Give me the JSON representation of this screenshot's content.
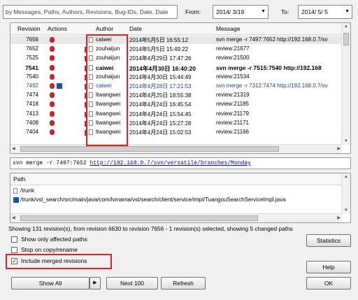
{
  "filter": {
    "placeholder": "by Messages, Paths, Authors, Revisions, Bug-IDs, Date, Date",
    "from_label": "From:",
    "from_value": "2014/ 3/19",
    "to_label": "To:",
    "to_value": "2014/ 5/ 5"
  },
  "log": {
    "columns": [
      "Revision",
      "Actions",
      "Author",
      "Date",
      "Message"
    ],
    "rows": [
      {
        "rev": "7656",
        "author": "caiwei",
        "date": "2014年5月5日 16:55:12",
        "msg": "svn merge -r 7497:7652 http://192.168.0.7/sv"
      },
      {
        "rev": "7652",
        "author": "zouhaijun",
        "date": "2014年5月5日 15:49:22",
        "msg": "review:21677"
      },
      {
        "rev": "7525",
        "author": "zouhaijun",
        "date": "2014年4月29日 17:47:26",
        "msg": "review:21500"
      },
      {
        "rev": "7541",
        "author": "caiwei",
        "date": "2014年4月30日 16:40:20",
        "msg": "svn merge -r 7515:7540 http://192.168"
      },
      {
        "rev": "7540",
        "author": "zouhaijun",
        "date": "2014年4月30日 15:44:49",
        "msg": "review:21534"
      },
      {
        "rev": "7492",
        "author": "caiwei",
        "date": "2014年4月28日 17:21:53",
        "msg": "svn merge -r 7312:7474 http://192.168.0.7/sv"
      },
      {
        "rev": "7474",
        "author": "ltwangwei",
        "date": "2014年4月25日 18:55:38",
        "msg": "review:21319"
      },
      {
        "rev": "7418",
        "author": "ltwangwei",
        "date": "2014年4月24日 16:45:54",
        "msg": "review:21185"
      },
      {
        "rev": "7413",
        "author": "ltwangwei",
        "date": "2014年4月24日 15:54:45",
        "msg": "review:21179"
      },
      {
        "rev": "7408",
        "author": "ltwangwei",
        "date": "2014年4月24日 15:27:28",
        "msg": "review:21171"
      },
      {
        "rev": "7404",
        "author": "ltwangwei",
        "date": "2014年4月24日 15:02:53",
        "msg": "review:21166"
      }
    ]
  },
  "message": {
    "prefix": "svn merge -r 7497:7652 ",
    "link": "http://192.168.0.7/svn/versatile/branches/Monday"
  },
  "paths": {
    "header": "Path",
    "items": [
      "/trunk",
      "/trunk/vst_search/src/main/java/com/lvmama/vst/search/client/service/impl/TuangouSearchServiceImpl.java"
    ]
  },
  "status": "Showing 131 revision(s), from revision 6630 to revision 7656 - 1 revision(s) selected, showing 5 changed paths",
  "options": {
    "affected": "Show only affected paths",
    "stop_copy": "Stop on copy/rename",
    "include_merged": "Include merged revisions",
    "include_merged_checked": true
  },
  "buttons": {
    "statistics": "Statistics",
    "help": "Help",
    "show_all": "Show All",
    "next100": "Next 100",
    "refresh": "Refresh",
    "ok": "OK"
  },
  "colors": {
    "highlight": "#e02020",
    "link": "#0000ee",
    "merged_blue": "#1c4aa6"
  }
}
